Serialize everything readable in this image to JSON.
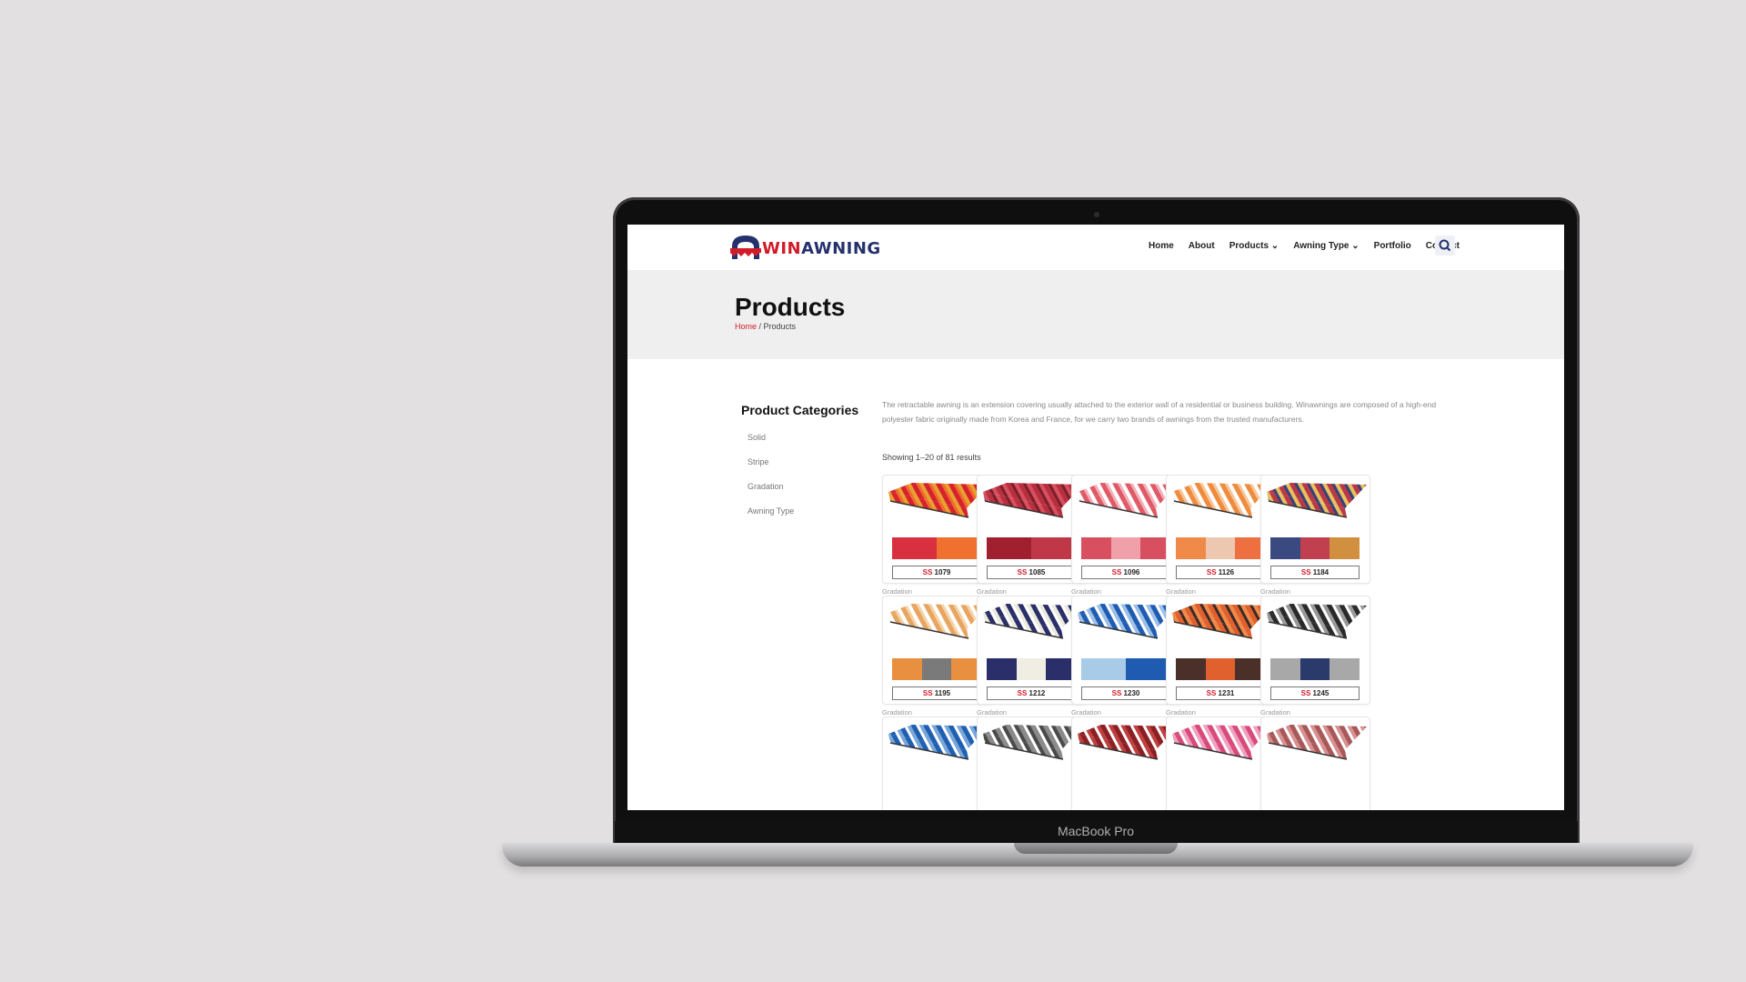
{
  "device": {
    "label": "MacBook Pro"
  },
  "site": {
    "logo": {
      "text_win": "WIN",
      "text_awning": "AWNING"
    },
    "nav": [
      {
        "label": "Home"
      },
      {
        "label": "About"
      },
      {
        "label": "Products ⌄"
      },
      {
        "label": "Awning Type ⌄"
      },
      {
        "label": "Portfolio"
      },
      {
        "label": "Contact"
      }
    ],
    "search_icon": "search-icon"
  },
  "banner": {
    "title": "Products",
    "breadcrumb_home": "Home",
    "breadcrumb_sep": " / ",
    "breadcrumb_current": "Products"
  },
  "sidebar": {
    "title": "Product Categories",
    "categories": [
      "Solid",
      "Stripe",
      "Gradation",
      "Awning Type"
    ]
  },
  "intro": "The retractable awning is an extension covering usually attached to the exterior wall of a residential or business building. Winawnings are composed of a high-end polyester fabric originally made from Korea and France, for we carry two brands of awnings from the trusted manufacturers.",
  "showing": "Showing 1–20 of 81 results",
  "products": [
    {
      "category": "Gradation",
      "name": "SS 1079",
      "ss": "SS",
      "num": "1079",
      "colors": [
        "#d6222e",
        "#f06a2e",
        "#e8a030"
      ],
      "swatch": [
        "#d93040",
        "#f07030"
      ]
    },
    {
      "category": "Gradation",
      "name": "SS 1085",
      "ss": "SS",
      "num": "1085",
      "colors": [
        "#b8303f",
        "#7a1f2a",
        "#d85060"
      ],
      "swatch": [
        "#a02030",
        "#c03848"
      ]
    },
    {
      "category": "Gradation",
      "name": "SS 1096",
      "ss": "SS",
      "num": "1096",
      "colors": [
        "#e05a66",
        "#f3b0b8",
        "#ffffff"
      ],
      "swatch": [
        "#d85060",
        "#f0a0a8",
        "#d85060"
      ]
    },
    {
      "category": "Gradation",
      "name": "SS 1126",
      "ss": "SS",
      "num": "1126",
      "colors": [
        "#f08a3c",
        "#f6c79a",
        "#ffffff"
      ],
      "swatch": [
        "#f08a48",
        "#ecc8b0",
        "#ee7040"
      ]
    },
    {
      "category": "Gradation",
      "name": "SS 1184",
      "ss": "SS",
      "num": "1184",
      "colors": [
        "#b83a48",
        "#34427a",
        "#e8c060"
      ],
      "swatch": [
        "#3a4a80",
        "#c04050",
        "#d09040"
      ]
    },
    {
      "category": "Gradation",
      "name": "SS 1195",
      "ss": "SS",
      "num": "1195",
      "colors": [
        "#e8a560",
        "#f4d3a8",
        "#ffffff"
      ],
      "swatch": [
        "#e89040",
        "#7a7a7a",
        "#e89040"
      ]
    },
    {
      "category": "Gradation",
      "name": "SS 1212",
      "ss": "SS",
      "num": "1212",
      "colors": [
        "#2a2f6a",
        "#ffffff",
        "#ecebdf"
      ],
      "swatch": [
        "#2a2f6a",
        "#f0eee2",
        "#2a2f6a"
      ]
    },
    {
      "category": "Gradation",
      "name": "SS 1230",
      "ss": "SS",
      "num": "1230",
      "colors": [
        "#1f5bb0",
        "#ffffff",
        "#9cc0e8"
      ],
      "swatch": [
        "#a8cbe8",
        "#1f5bb0"
      ]
    },
    {
      "category": "Gradation",
      "name": "SS 1231",
      "ss": "SS",
      "num": "1231",
      "colors": [
        "#e0602e",
        "#3a2a28",
        "#f08a4a"
      ],
      "swatch": [
        "#4a3028",
        "#e0602e",
        "#4a3028"
      ]
    },
    {
      "category": "Gradation",
      "name": "SS 1245",
      "ss": "SS",
      "num": "1245",
      "colors": [
        "#2a2a2a",
        "#ffffff",
        "#9a9a9a"
      ],
      "swatch": [
        "#a8a8a8",
        "#2a3a6a",
        "#a8a8a8"
      ]
    },
    {
      "category": "",
      "name": "",
      "colors": [
        "#1f5fb0",
        "#ffffff",
        "#7aa6da"
      ]
    },
    {
      "category": "",
      "name": "",
      "colors": [
        "#8a8a8a",
        "#ffffff",
        "#4a4a4a"
      ]
    },
    {
      "category": "",
      "name": "",
      "colors": [
        "#8a1f24",
        "#ffffff",
        "#c04040"
      ]
    },
    {
      "category": "",
      "name": "",
      "colors": [
        "#d84a7a",
        "#ffffff",
        "#f0a0c0"
      ]
    },
    {
      "category": "",
      "name": "",
      "colors": [
        "#a85858",
        "#ffffff",
        "#d89090"
      ]
    }
  ]
}
